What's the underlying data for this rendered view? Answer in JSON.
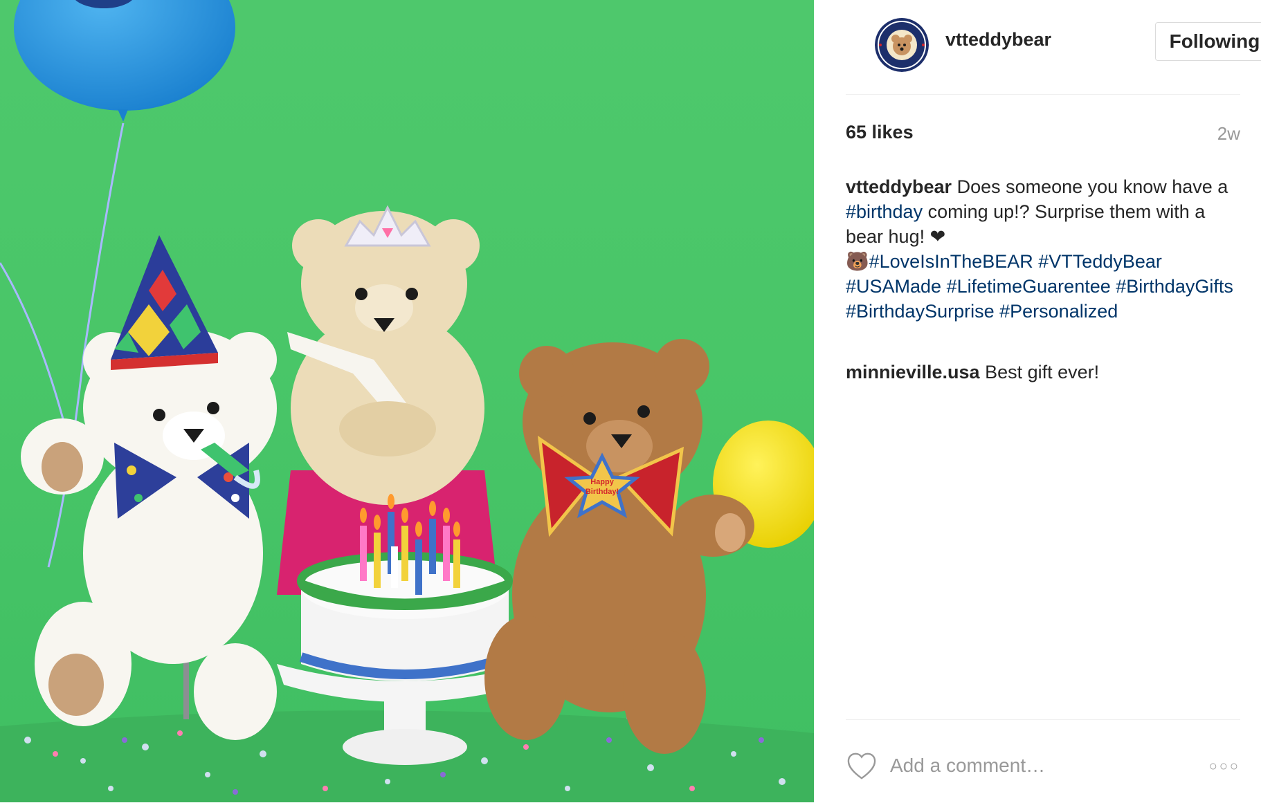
{
  "post": {
    "username": "vtteddybear",
    "follow_button": "Following",
    "likes": "65 likes",
    "time": "2w",
    "avatar_logo_text": [
      "VERMONT",
      "TEDDY BEAR"
    ],
    "photo_text": {
      "badge": [
        "Happy",
        "Birthday!"
      ]
    }
  },
  "caption": {
    "username": "vtteddybear",
    "text1": " Does someone you know have a ",
    "tag_birthday": "#birthday",
    "text2": " coming up!? Surprise them with a bear hug! ",
    "heart_emoji": "❤",
    "bear_emoji": "🐻",
    "tags": [
      "#LoveIsInTheBEAR",
      "#VTTeddyBear",
      "#USAMade",
      "#LifetimeGuarentee",
      "#BirthdayGifts",
      "#BirthdaySurprise",
      "#Personalized"
    ]
  },
  "comments": [
    {
      "username": "minnieville.usa",
      "text": " Best gift ever!"
    }
  ],
  "footer": {
    "comment_placeholder": "Add a comment…",
    "like_icon": "heart-icon",
    "more_icon": "more-options-icon",
    "more_glyph": "○○○"
  },
  "colors": {
    "photo_background": "#4ec86c",
    "hashtag": "#003569",
    "muted": "#999999",
    "text": "#262626"
  }
}
